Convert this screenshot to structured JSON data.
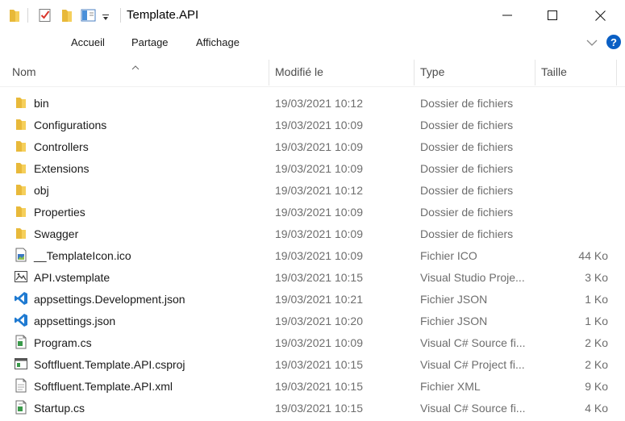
{
  "window": {
    "title": "Template.API",
    "controls": [
      "minimize-icon",
      "maximize-icon",
      "close-icon"
    ]
  },
  "quick_access": [
    {
      "icon": "folder-icon"
    },
    {
      "icon": "properties-checkmark-icon"
    },
    {
      "icon": "new-folder-icon"
    },
    {
      "icon": "view-pane-icon"
    },
    {
      "icon": "customize-dropdown-icon"
    }
  ],
  "ribbon": {
    "tabs": [
      "Accueil",
      "Partage",
      "Affichage"
    ],
    "help_label": "?"
  },
  "columns": {
    "name": "Nom",
    "modified": "Modifié le",
    "type": "Type",
    "size": "Taille",
    "sorted_by": "Nom"
  },
  "colors": {
    "folder": "#e8b93a",
    "vscode": "#1f7ad1",
    "accent": "#0a5fc4"
  },
  "files": [
    {
      "name": "bin",
      "modified": "19/03/2021 10:12",
      "type": "Dossier de fichiers",
      "size": "",
      "icon": "folder"
    },
    {
      "name": "Configurations",
      "modified": "19/03/2021 10:09",
      "type": "Dossier de fichiers",
      "size": "",
      "icon": "folder"
    },
    {
      "name": "Controllers",
      "modified": "19/03/2021 10:09",
      "type": "Dossier de fichiers",
      "size": "",
      "icon": "folder"
    },
    {
      "name": "Extensions",
      "modified": "19/03/2021 10:09",
      "type": "Dossier de fichiers",
      "size": "",
      "icon": "folder"
    },
    {
      "name": "obj",
      "modified": "19/03/2021 10:12",
      "type": "Dossier de fichiers",
      "size": "",
      "icon": "folder"
    },
    {
      "name": "Properties",
      "modified": "19/03/2021 10:09",
      "type": "Dossier de fichiers",
      "size": "",
      "icon": "folder"
    },
    {
      "name": "Swagger",
      "modified": "19/03/2021 10:09",
      "type": "Dossier de fichiers",
      "size": "",
      "icon": "folder"
    },
    {
      "name": "__TemplateIcon.ico",
      "modified": "19/03/2021 10:09",
      "type": "Fichier ICO",
      "size": "44 Ko",
      "icon": "image"
    },
    {
      "name": "API.vstemplate",
      "modified": "19/03/2021 10:15",
      "type": "Visual Studio Proje...",
      "size": "3 Ko",
      "icon": "vstemplate"
    },
    {
      "name": "appsettings.Development.json",
      "modified": "19/03/2021 10:21",
      "type": "Fichier JSON",
      "size": "1 Ko",
      "icon": "vscode"
    },
    {
      "name": "appsettings.json",
      "modified": "19/03/2021 10:20",
      "type": "Fichier JSON",
      "size": "1 Ko",
      "icon": "vscode"
    },
    {
      "name": "Program.cs",
      "modified": "19/03/2021 10:09",
      "type": "Visual C# Source fi...",
      "size": "2 Ko",
      "icon": "code-file"
    },
    {
      "name": "Softfluent.Template.API.csproj",
      "modified": "19/03/2021 10:15",
      "type": "Visual C# Project fi...",
      "size": "2 Ko",
      "icon": "project-file"
    },
    {
      "name": "Softfluent.Template.API.xml",
      "modified": "19/03/2021 10:15",
      "type": "Fichier XML",
      "size": "9 Ko",
      "icon": "document"
    },
    {
      "name": "Startup.cs",
      "modified": "19/03/2021 10:15",
      "type": "Visual C# Source fi...",
      "size": "4 Ko",
      "icon": "code-file"
    }
  ]
}
